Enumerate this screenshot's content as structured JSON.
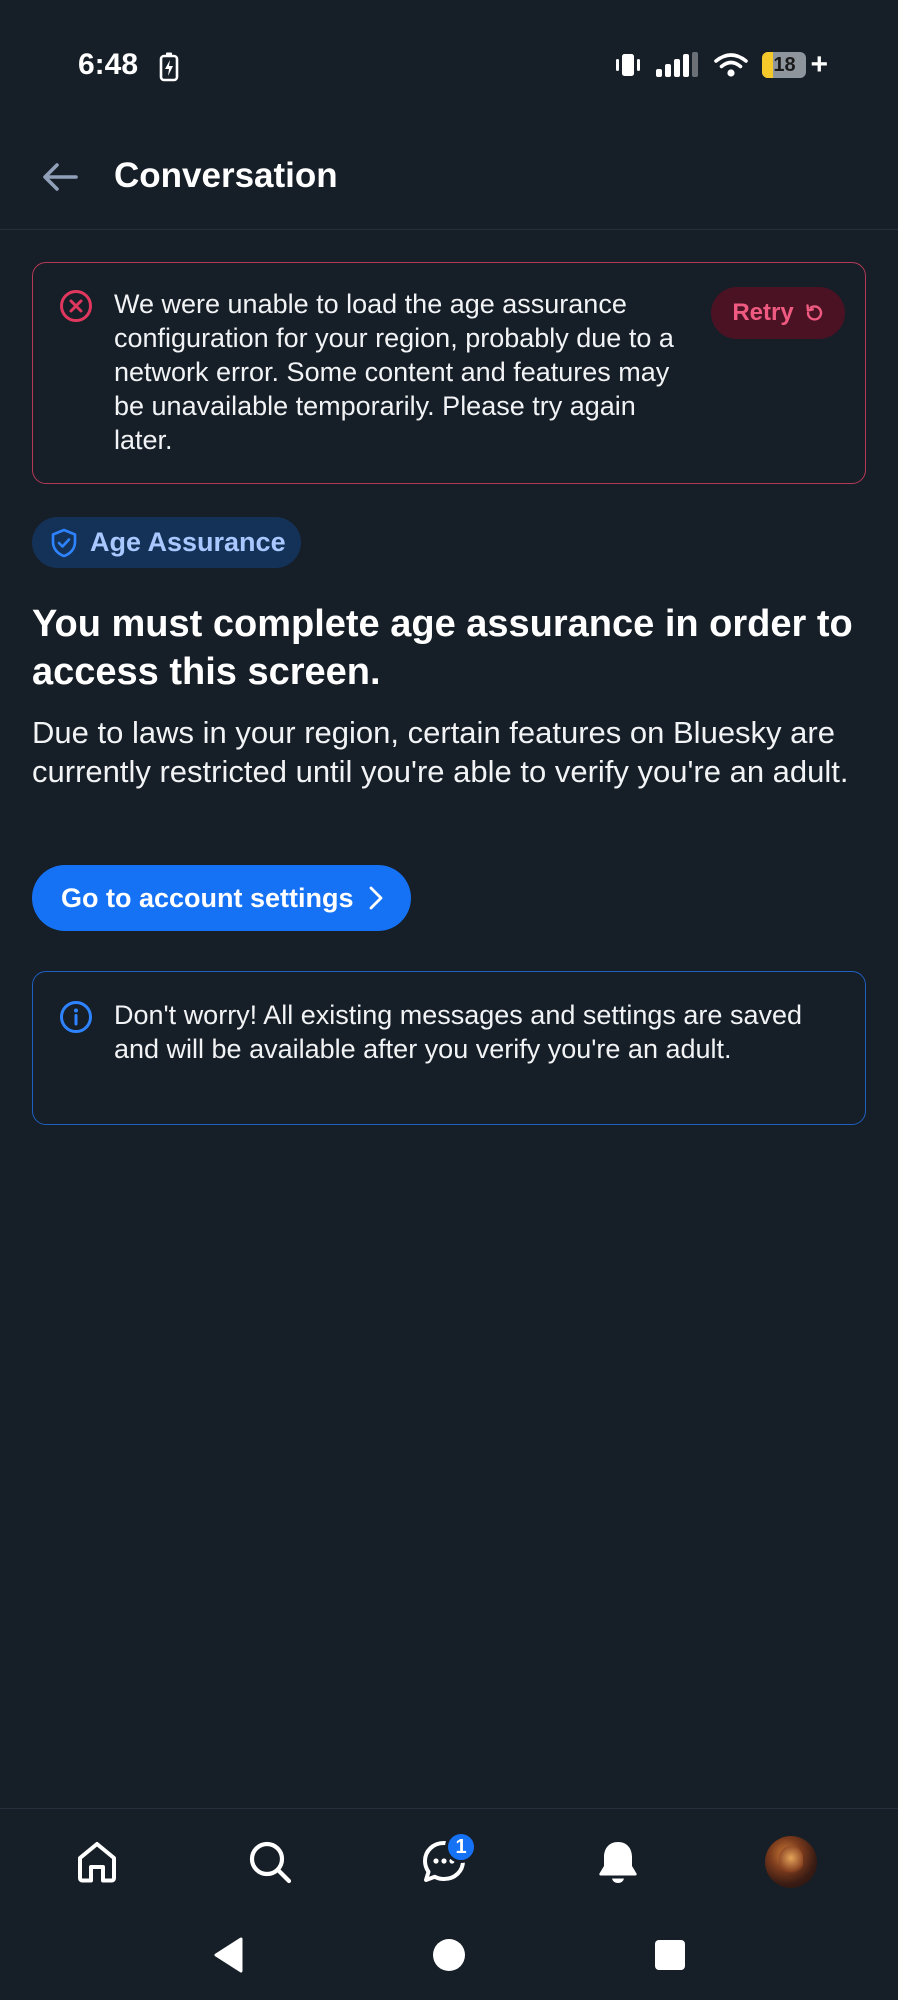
{
  "status_bar": {
    "time": "6:48",
    "battery_level": "18",
    "battery_plus": "+"
  },
  "header": {
    "title": "Conversation",
    "back_icon": "arrow-left-icon"
  },
  "error_card": {
    "message": "We were unable to load the age assurance configuration for your region, probably due to a network error. Some content and features may be unavailable temporarily. Please try again later.",
    "retry_label": "Retry",
    "icon": "error-circle-x-icon",
    "accent_color": "#e0375f"
  },
  "age_pill": {
    "label": "Age Assurance",
    "icon": "shield-check-icon"
  },
  "main": {
    "heading": "You must complete age assurance in order to access this screen.",
    "body": "Due to laws in your region, certain features on Bluesky are currently restricted until you're able to verify you're an adult.",
    "settings_button_label": "Go to account settings"
  },
  "info_card": {
    "message": "Don't worry! All existing messages and settings are saved and will be available after you verify you're an adult.",
    "icon": "info-circle-icon"
  },
  "tab_bar": {
    "tabs": [
      {
        "name": "home",
        "icon": "home-icon"
      },
      {
        "name": "search",
        "icon": "search-icon"
      },
      {
        "name": "chat",
        "icon": "chat-bubble-icon",
        "badge": "1"
      },
      {
        "name": "notifications",
        "icon": "bell-icon"
      },
      {
        "name": "profile",
        "icon": "avatar"
      }
    ]
  },
  "colors": {
    "background": "#161e27",
    "primary": "#1672f5",
    "error_border": "#b33a55",
    "retry_bg": "#4b1224",
    "retry_text": "#ee5a80",
    "info_border": "#1f5fbf",
    "pill_bg": "#143258",
    "pill_text": "#a9c8ff"
  }
}
